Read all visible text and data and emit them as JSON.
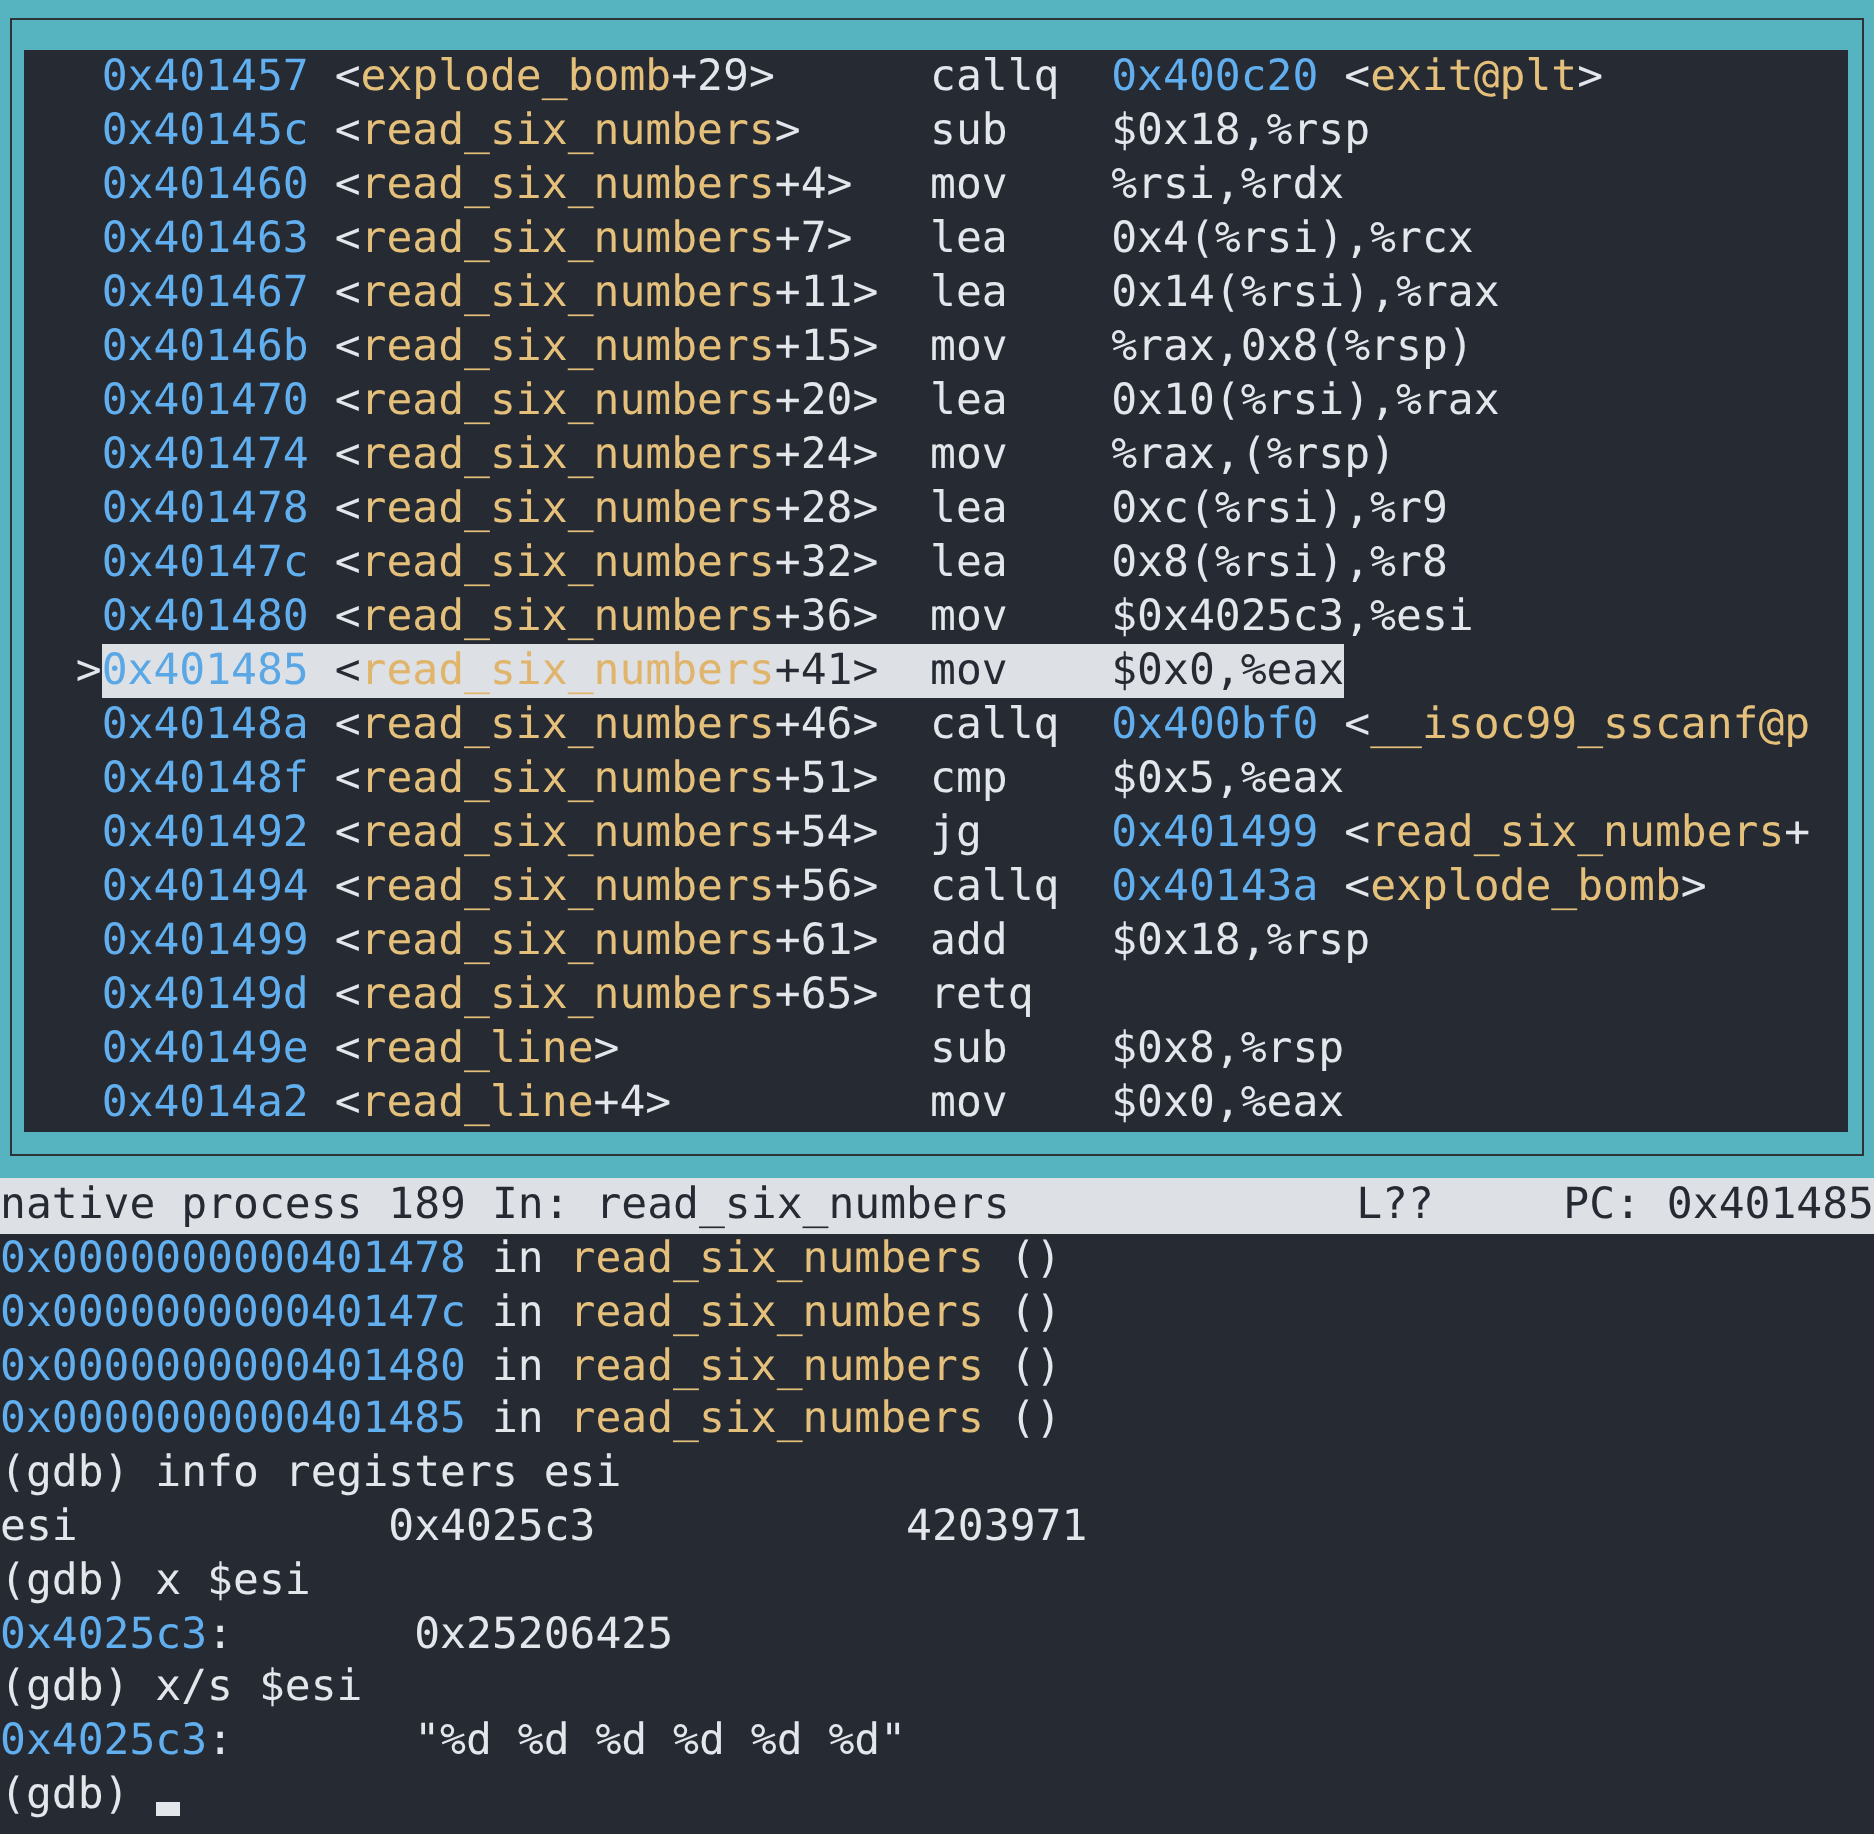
{
  "disassembly": {
    "current_marker": ">",
    "rows": [
      {
        "address": "0x401457",
        "symbol": [
          {
            "kind": "plain",
            "text": "<"
          },
          {
            "kind": "sym",
            "text": "explode_bomb"
          },
          {
            "kind": "plain",
            "text": "+29>"
          }
        ],
        "mnemonic": "callq",
        "operands": [
          {
            "kind": "addr",
            "text": "0x400c20"
          },
          {
            "kind": "plain",
            "text": " <"
          },
          {
            "kind": "sym",
            "text": "exit@plt"
          },
          {
            "kind": "plain",
            "text": ">"
          }
        ],
        "selected": false
      },
      {
        "address": "0x40145c",
        "symbol": [
          {
            "kind": "plain",
            "text": "<"
          },
          {
            "kind": "sym",
            "text": "read_six_numbers"
          },
          {
            "kind": "plain",
            "text": ">"
          }
        ],
        "mnemonic": "sub",
        "operands": [
          {
            "kind": "plain",
            "text": "$0x18,%rsp"
          }
        ],
        "selected": false
      },
      {
        "address": "0x401460",
        "symbol": [
          {
            "kind": "plain",
            "text": "<"
          },
          {
            "kind": "sym",
            "text": "read_six_numbers"
          },
          {
            "kind": "plain",
            "text": "+4>"
          }
        ],
        "mnemonic": "mov",
        "operands": [
          {
            "kind": "plain",
            "text": "%rsi,%rdx"
          }
        ],
        "selected": false
      },
      {
        "address": "0x401463",
        "symbol": [
          {
            "kind": "plain",
            "text": "<"
          },
          {
            "kind": "sym",
            "text": "read_six_numbers"
          },
          {
            "kind": "plain",
            "text": "+7>"
          }
        ],
        "mnemonic": "lea",
        "operands": [
          {
            "kind": "plain",
            "text": "0x4(%rsi),%rcx"
          }
        ],
        "selected": false
      },
      {
        "address": "0x401467",
        "symbol": [
          {
            "kind": "plain",
            "text": "<"
          },
          {
            "kind": "sym",
            "text": "read_six_numbers"
          },
          {
            "kind": "plain",
            "text": "+11>"
          }
        ],
        "mnemonic": "lea",
        "operands": [
          {
            "kind": "plain",
            "text": "0x14(%rsi),%rax"
          }
        ],
        "selected": false
      },
      {
        "address": "0x40146b",
        "symbol": [
          {
            "kind": "plain",
            "text": "<"
          },
          {
            "kind": "sym",
            "text": "read_six_numbers"
          },
          {
            "kind": "plain",
            "text": "+15>"
          }
        ],
        "mnemonic": "mov",
        "operands": [
          {
            "kind": "plain",
            "text": "%rax,0x8(%rsp)"
          }
        ],
        "selected": false
      },
      {
        "address": "0x401470",
        "symbol": [
          {
            "kind": "plain",
            "text": "<"
          },
          {
            "kind": "sym",
            "text": "read_six_numbers"
          },
          {
            "kind": "plain",
            "text": "+20>"
          }
        ],
        "mnemonic": "lea",
        "operands": [
          {
            "kind": "plain",
            "text": "0x10(%rsi),%rax"
          }
        ],
        "selected": false
      },
      {
        "address": "0x401474",
        "symbol": [
          {
            "kind": "plain",
            "text": "<"
          },
          {
            "kind": "sym",
            "text": "read_six_numbers"
          },
          {
            "kind": "plain",
            "text": "+24>"
          }
        ],
        "mnemonic": "mov",
        "operands": [
          {
            "kind": "plain",
            "text": "%rax,(%rsp)"
          }
        ],
        "selected": false
      },
      {
        "address": "0x401478",
        "symbol": [
          {
            "kind": "plain",
            "text": "<"
          },
          {
            "kind": "sym",
            "text": "read_six_numbers"
          },
          {
            "kind": "plain",
            "text": "+28>"
          }
        ],
        "mnemonic": "lea",
        "operands": [
          {
            "kind": "plain",
            "text": "0xc(%rsi),%r9"
          }
        ],
        "selected": false
      },
      {
        "address": "0x40147c",
        "symbol": [
          {
            "kind": "plain",
            "text": "<"
          },
          {
            "kind": "sym",
            "text": "read_six_numbers"
          },
          {
            "kind": "plain",
            "text": "+32>"
          }
        ],
        "mnemonic": "lea",
        "operands": [
          {
            "kind": "plain",
            "text": "0x8(%rsi),%r8"
          }
        ],
        "selected": false
      },
      {
        "address": "0x401480",
        "symbol": [
          {
            "kind": "plain",
            "text": "<"
          },
          {
            "kind": "sym",
            "text": "read_six_numbers"
          },
          {
            "kind": "plain",
            "text": "+36>"
          }
        ],
        "mnemonic": "mov",
        "operands": [
          {
            "kind": "plain",
            "text": "$0x4025c3,%esi"
          }
        ],
        "selected": false
      },
      {
        "address": "0x401485",
        "symbol": [
          {
            "kind": "plain",
            "text": "<"
          },
          {
            "kind": "sym",
            "text": "read_six_numbers"
          },
          {
            "kind": "plain",
            "text": "+41>"
          }
        ],
        "mnemonic": "mov",
        "operands": [
          {
            "kind": "plain",
            "text": "$0x0,%eax"
          }
        ],
        "selected": true
      },
      {
        "address": "0x40148a",
        "symbol": [
          {
            "kind": "plain",
            "text": "<"
          },
          {
            "kind": "sym",
            "text": "read_six_numbers"
          },
          {
            "kind": "plain",
            "text": "+46>"
          }
        ],
        "mnemonic": "callq",
        "operands": [
          {
            "kind": "addr",
            "text": "0x400bf0"
          },
          {
            "kind": "plain",
            "text": " <"
          },
          {
            "kind": "sym",
            "text": "__isoc99_sscanf@p"
          }
        ],
        "selected": false
      },
      {
        "address": "0x40148f",
        "symbol": [
          {
            "kind": "plain",
            "text": "<"
          },
          {
            "kind": "sym",
            "text": "read_six_numbers"
          },
          {
            "kind": "plain",
            "text": "+51>"
          }
        ],
        "mnemonic": "cmp",
        "operands": [
          {
            "kind": "plain",
            "text": "$0x5,%eax"
          }
        ],
        "selected": false
      },
      {
        "address": "0x401492",
        "symbol": [
          {
            "kind": "plain",
            "text": "<"
          },
          {
            "kind": "sym",
            "text": "read_six_numbers"
          },
          {
            "kind": "plain",
            "text": "+54>"
          }
        ],
        "mnemonic": "jg",
        "operands": [
          {
            "kind": "addr",
            "text": "0x401499"
          },
          {
            "kind": "plain",
            "text": " <"
          },
          {
            "kind": "sym",
            "text": "read_six_numbers"
          },
          {
            "kind": "plain",
            "text": "+"
          }
        ],
        "selected": false
      },
      {
        "address": "0x401494",
        "symbol": [
          {
            "kind": "plain",
            "text": "<"
          },
          {
            "kind": "sym",
            "text": "read_six_numbers"
          },
          {
            "kind": "plain",
            "text": "+56>"
          }
        ],
        "mnemonic": "callq",
        "operands": [
          {
            "kind": "addr",
            "text": "0x40143a"
          },
          {
            "kind": "plain",
            "text": " <"
          },
          {
            "kind": "sym",
            "text": "explode_bomb"
          },
          {
            "kind": "plain",
            "text": ">"
          }
        ],
        "selected": false
      },
      {
        "address": "0x401499",
        "symbol": [
          {
            "kind": "plain",
            "text": "<"
          },
          {
            "kind": "sym",
            "text": "read_six_numbers"
          },
          {
            "kind": "plain",
            "text": "+61>"
          }
        ],
        "mnemonic": "add",
        "operands": [
          {
            "kind": "plain",
            "text": "$0x18,%rsp"
          }
        ],
        "selected": false
      },
      {
        "address": "0x40149d",
        "symbol": [
          {
            "kind": "plain",
            "text": "<"
          },
          {
            "kind": "sym",
            "text": "read_six_numbers"
          },
          {
            "kind": "plain",
            "text": "+65>"
          }
        ],
        "mnemonic": "retq",
        "operands": [],
        "selected": false
      },
      {
        "address": "0x40149e",
        "symbol": [
          {
            "kind": "plain",
            "text": "<"
          },
          {
            "kind": "sym",
            "text": "read_line"
          },
          {
            "kind": "plain",
            "text": ">"
          }
        ],
        "mnemonic": "sub",
        "operands": [
          {
            "kind": "plain",
            "text": "$0x8,%rsp"
          }
        ],
        "selected": false
      },
      {
        "address": "0x4014a2",
        "symbol": [
          {
            "kind": "plain",
            "text": "<"
          },
          {
            "kind": "sym",
            "text": "read_line"
          },
          {
            "kind": "plain",
            "text": "+4>"
          }
        ],
        "mnemonic": "mov",
        "operands": [
          {
            "kind": "plain",
            "text": "$0x0,%eax"
          }
        ],
        "selected": false
      }
    ]
  },
  "status_bar": {
    "process": "native process 189 In: read_six_numbers",
    "line": "L??",
    "pc": "PC: 0x401485"
  },
  "console": {
    "lines": [
      [
        {
          "kind": "addr",
          "text": "0x0000000000401478"
        },
        {
          "kind": "plain",
          "text": " in "
        },
        {
          "kind": "sym",
          "text": "read_six_numbers"
        },
        {
          "kind": "plain",
          "text": " ()"
        }
      ],
      [
        {
          "kind": "addr",
          "text": "0x000000000040147c"
        },
        {
          "kind": "plain",
          "text": " in "
        },
        {
          "kind": "sym",
          "text": "read_six_numbers"
        },
        {
          "kind": "plain",
          "text": " ()"
        }
      ],
      [
        {
          "kind": "addr",
          "text": "0x0000000000401480"
        },
        {
          "kind": "plain",
          "text": " in "
        },
        {
          "kind": "sym",
          "text": "read_six_numbers"
        },
        {
          "kind": "plain",
          "text": " ()"
        }
      ],
      [
        {
          "kind": "addr",
          "text": "0x0000000000401485"
        },
        {
          "kind": "plain",
          "text": " in "
        },
        {
          "kind": "sym",
          "text": "read_six_numbers"
        },
        {
          "kind": "plain",
          "text": " ()"
        }
      ],
      [
        {
          "kind": "plain",
          "text": "(gdb) info registers esi"
        }
      ],
      [
        {
          "kind": "plain",
          "text": "esi            0x4025c3            4203971"
        }
      ],
      [
        {
          "kind": "plain",
          "text": "(gdb) x $esi"
        }
      ],
      [
        {
          "kind": "addr",
          "text": "0x4025c3"
        },
        {
          "kind": "plain",
          "text": ":       0x25206425"
        }
      ],
      [
        {
          "kind": "plain",
          "text": "(gdb) x/s $esi"
        }
      ],
      [
        {
          "kind": "addr",
          "text": "0x4025c3"
        },
        {
          "kind": "plain",
          "text": ":       \"%d %d %d %d %d %d\""
        }
      ],
      [
        {
          "kind": "plain",
          "text": "(gdb) "
        }
      ]
    ],
    "cursor": true
  }
}
